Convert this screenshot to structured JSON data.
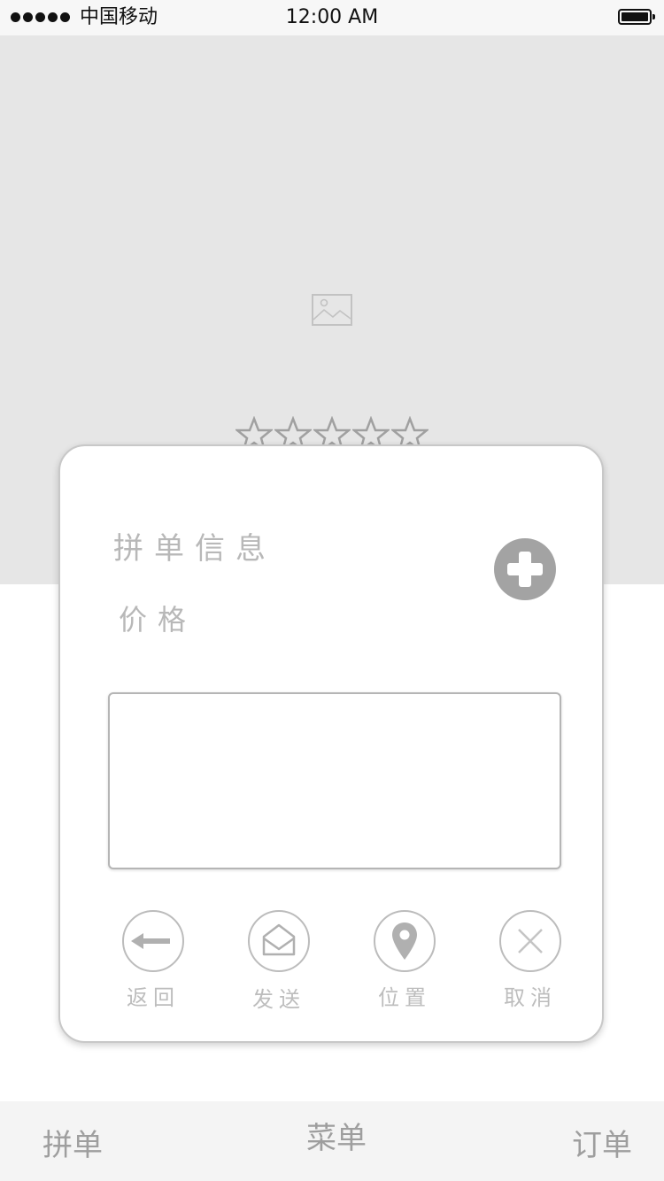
{
  "status_bar": {
    "carrier": "中国移动",
    "time": "12:00 AM"
  },
  "hero": {
    "image_icon": "image-placeholder-icon",
    "rating": {
      "value": 0,
      "max": 5,
      "icon": "star-outline-icon"
    }
  },
  "card": {
    "title": "拼单信息",
    "price_label": "价格",
    "add_icon": "plus-circle-icon",
    "message_value": "",
    "actions": [
      {
        "label": "返回",
        "icon": "arrow-left-icon"
      },
      {
        "label": "发送",
        "icon": "envelope-open-icon"
      },
      {
        "label": "位置",
        "icon": "location-pin-icon"
      },
      {
        "label": "取消",
        "icon": "close-icon"
      }
    ]
  },
  "tab_bar": {
    "items": [
      {
        "label": "拼单"
      },
      {
        "label": "菜单"
      },
      {
        "label": "订单"
      }
    ]
  },
  "colors": {
    "hero_background": "#e6e6e6",
    "muted_text": "#b8b8b8",
    "icon_gray": "#a3a3a3",
    "tab_bar_background": "#f4f4f4"
  }
}
